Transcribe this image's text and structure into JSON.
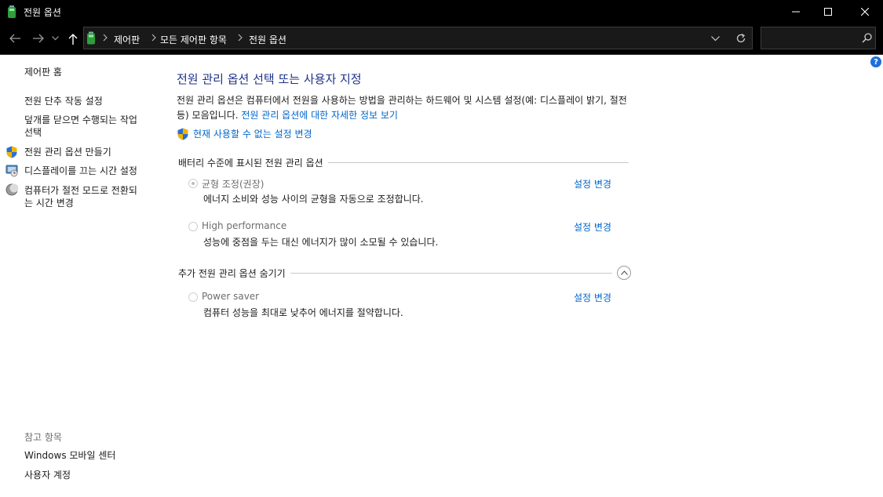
{
  "window": {
    "title": "전원 옵션"
  },
  "breadcrumb": [
    "제어판",
    "모든 제어판 항목",
    "전원 옵션"
  ],
  "sidebar": {
    "home": "제어판 홈",
    "links": [
      {
        "label": "전원 단추 작동 설정",
        "icon": ""
      },
      {
        "label": "덮개를 닫으면 수행되는 작업\n선택",
        "icon": ""
      },
      {
        "label": "전원 관리 옵션 만들기",
        "icon": "shield-icon"
      },
      {
        "label": "디스플레이를 끄는 시간 설정",
        "icon": "display-icon"
      },
      {
        "label": "컴퓨터가 절전 모드로 전환되\n는 시간 변경",
        "icon": "moon-icon"
      }
    ],
    "see_also": "참고 항목",
    "see_also_links": [
      "Windows 모바일 센터",
      "사용자 계정"
    ]
  },
  "main": {
    "heading": "전원 관리 옵션 선택 또는 사용자 지정",
    "description": "전원 관리 옵션은 컴퓨터에서 전원을 사용하는 방법을 관리하는 하드웨어 및 시스템 설정(예: 디스플레이 밝기, 절전 등) 모음입니다.",
    "description_link": "전원 관리 옵션에 대한 자세한 정보 보기",
    "uac_link": "현재 사용할 수 없는 설정 변경",
    "battery_section": "배터리 수준에 표시된 전원 관리 옵션",
    "hidden_section": "추가 전원 관리 옵션 숨기기",
    "change_label": "설정 변경",
    "plans": [
      {
        "name": "균형 조정(권장)",
        "desc": "에너지 소비와 성능 사이의 균형을 자동으로 조정합니다.",
        "selected": true
      },
      {
        "name": "High performance",
        "desc": "성능에 중점을 두는 대신 에너지가 많이 소모될 수 있습니다.",
        "selected": false
      },
      {
        "name": "Power saver",
        "desc": "컴퓨터 성능을 최대로 낮추어 에너지를 절약합니다.",
        "selected": false
      }
    ]
  },
  "colors": {
    "link": "#0066cc",
    "heading": "#1e3287",
    "titlebar": "#000000"
  }
}
